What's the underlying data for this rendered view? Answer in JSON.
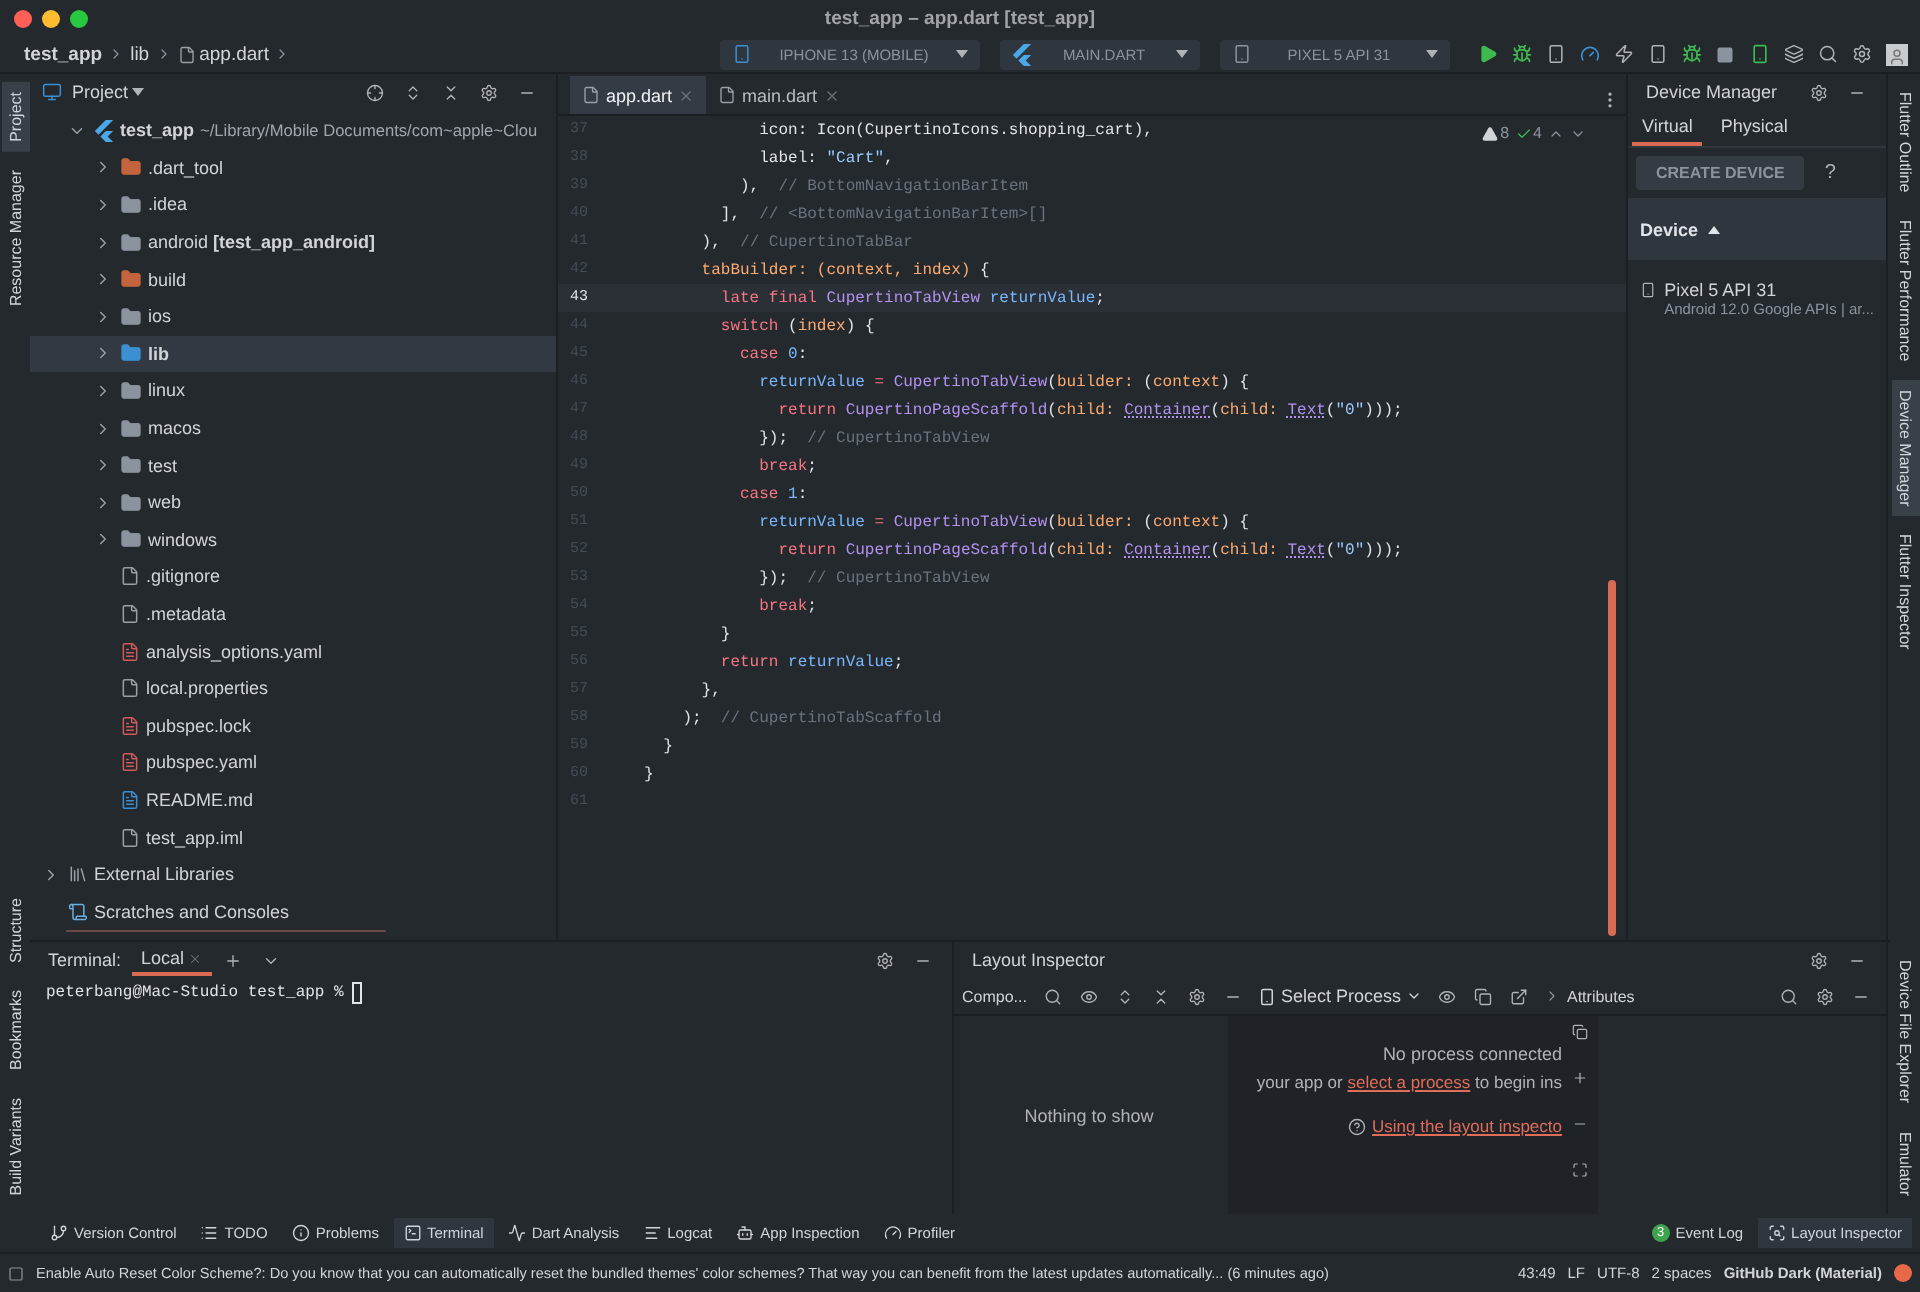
{
  "window": {
    "title": "test_app – app.dart [test_app]"
  },
  "breadcrumb": [
    "test_app",
    "lib",
    "app.dart"
  ],
  "run_toolbar": {
    "device": "IPHONE 13 (MOBILE)",
    "config": "MAIN.DART",
    "target": "PIXEL 5 API 31"
  },
  "left_tool_strip": {
    "top": [
      {
        "label": "Project",
        "selected": true
      },
      {
        "label": "Resource Manager",
        "selected": false
      }
    ],
    "bottom": [
      {
        "label": "Structure",
        "selected": false
      },
      {
        "label": "Bookmarks",
        "selected": false
      },
      {
        "label": "Build Variants",
        "selected": false
      }
    ]
  },
  "project_panel": {
    "title": "Project",
    "tree": [
      {
        "name": "test_app",
        "path": "~/Library/Mobile Documents/com~apple~Clou",
        "kind": "project",
        "expanded": true,
        "selected": false,
        "children": [
          {
            "name": ".dart_tool",
            "kind": "folder",
            "color": "#c4643c",
            "expanded": false,
            "selected": false
          },
          {
            "name": ".idea",
            "kind": "folder",
            "color": "#8b949e",
            "expanded": false,
            "selected": false
          },
          {
            "name": "android **[test_app_android]**",
            "kind": "folder",
            "color": "#8b949e",
            "expanded": false,
            "selected": false
          },
          {
            "name": "build",
            "kind": "folder",
            "color": "#c4643c",
            "expanded": false,
            "selected": false
          },
          {
            "name": "ios",
            "kind": "folder",
            "color": "#8b949e",
            "expanded": false,
            "selected": false
          },
          {
            "name": "lib",
            "kind": "folder",
            "color": "#3c8fd0",
            "expanded": false,
            "selected": true
          },
          {
            "name": "linux",
            "kind": "folder",
            "color": "#8b949e",
            "expanded": false,
            "selected": false
          },
          {
            "name": "macos",
            "kind": "folder",
            "color": "#8b949e",
            "expanded": false,
            "selected": false
          },
          {
            "name": "test",
            "kind": "folder",
            "color": "#8b949e",
            "expanded": false,
            "selected": false
          },
          {
            "name": "web",
            "kind": "folder",
            "color": "#8b949e",
            "expanded": false,
            "selected": false
          },
          {
            "name": "windows",
            "kind": "folder",
            "color": "#8b949e",
            "expanded": false,
            "selected": false
          },
          {
            "name": ".gitignore",
            "kind": "file",
            "selected": false
          },
          {
            "name": ".metadata",
            "kind": "file",
            "selected": false
          },
          {
            "name": "analysis_options.yaml",
            "kind": "yaml",
            "selected": false
          },
          {
            "name": "local.properties",
            "kind": "file",
            "selected": false
          },
          {
            "name": "pubspec.lock",
            "kind": "yaml",
            "selected": false
          },
          {
            "name": "pubspec.yaml",
            "kind": "yaml",
            "selected": false
          },
          {
            "name": "README.md",
            "kind": "markdown",
            "selected": false
          },
          {
            "name": "test_app.iml",
            "kind": "file",
            "selected": false
          }
        ]
      },
      {
        "name": "External Libraries",
        "kind": "library",
        "expanded": false,
        "selected": false
      },
      {
        "name": "Scratches and Consoles",
        "kind": "scratch",
        "selected": false
      }
    ]
  },
  "editor": {
    "tabs": [
      {
        "label": "app.dart",
        "selected": true
      },
      {
        "label": "main.dart",
        "selected": false
      }
    ],
    "inspections": {
      "warnings": "8",
      "passed": "4"
    },
    "lines": [
      {
        "number": "37",
        "current": false,
        "segments": [
          {
            "kind": "plain",
            "text": "            icon: Icon(CupertinoIcons.shopping_cart),"
          }
        ]
      },
      {
        "number": "38",
        "current": false,
        "segments": [
          {
            "kind": "plain",
            "text": "            label: "
          },
          {
            "kind": "string",
            "text": "\"Cart\""
          },
          {
            "kind": "plain",
            "text": ","
          }
        ]
      },
      {
        "number": "39",
        "current": false,
        "segments": [
          {
            "kind": "plain",
            "text": "          ),  "
          },
          {
            "kind": "comment",
            "text": "// BottomNavigationBarItem"
          }
        ]
      },
      {
        "number": "40",
        "current": false,
        "segments": [
          {
            "kind": "plain",
            "text": "        ],  "
          },
          {
            "kind": "comment",
            "text": "// <BottomNavigationBarItem>[]"
          }
        ]
      },
      {
        "number": "41",
        "current": false,
        "segments": [
          {
            "kind": "plain",
            "text": "      ),  "
          },
          {
            "kind": "comment",
            "text": "// CupertinoTabBar"
          }
        ]
      },
      {
        "number": "42",
        "current": false,
        "segments": [
          {
            "kind": "param",
            "text": "      tabBuilder: (context, index) "
          },
          {
            "kind": "plain",
            "text": "{"
          }
        ]
      },
      {
        "number": "43",
        "current": true,
        "segments": [
          {
            "kind": "keyword",
            "text": "        late final "
          },
          {
            "kind": "type",
            "text": "CupertinoTabView "
          },
          {
            "kind": "variable",
            "text": "returnValue"
          },
          {
            "kind": "plain",
            "text": ";"
          }
        ]
      },
      {
        "number": "44",
        "current": false,
        "segments": [
          {
            "kind": "keyword",
            "text": "        switch "
          },
          {
            "kind": "plain",
            "text": "("
          },
          {
            "kind": "param",
            "text": "index"
          },
          {
            "kind": "plain",
            "text": ") {"
          }
        ]
      },
      {
        "number": "45",
        "current": false,
        "segments": [
          {
            "kind": "keyword",
            "text": "          case "
          },
          {
            "kind": "variable",
            "text": "0"
          },
          {
            "kind": "plain",
            "text": ":"
          }
        ]
      },
      {
        "number": "46",
        "current": false,
        "segments": [
          {
            "kind": "variable",
            "text": "            returnValue "
          },
          {
            "kind": "keyword",
            "text": "= "
          },
          {
            "kind": "type",
            "text": "CupertinoTabView"
          },
          {
            "kind": "plain",
            "text": "("
          },
          {
            "kind": "param",
            "text": "builder: "
          },
          {
            "kind": "plain",
            "text": "("
          },
          {
            "kind": "param",
            "text": "context"
          },
          {
            "kind": "plain",
            "text": ") {"
          }
        ]
      },
      {
        "number": "47",
        "current": false,
        "segments": [
          {
            "kind": "keyword",
            "text": "              return "
          },
          {
            "kind": "type",
            "text": "CupertinoPageScaffold"
          },
          {
            "kind": "plain",
            "text": "("
          },
          {
            "kind": "param",
            "text": "child: "
          },
          {
            "kind": "link",
            "text": "Container"
          },
          {
            "kind": "plain",
            "text": "("
          },
          {
            "kind": "param",
            "text": "child: "
          },
          {
            "kind": "link",
            "text": "Text"
          },
          {
            "kind": "plain",
            "text": "("
          },
          {
            "kind": "string",
            "text": "\"0\""
          },
          {
            "kind": "plain",
            "text": ")));"
          }
        ]
      },
      {
        "number": "48",
        "current": false,
        "segments": [
          {
            "kind": "plain",
            "text": "            });  "
          },
          {
            "kind": "comment",
            "text": "// CupertinoTabView"
          }
        ]
      },
      {
        "number": "49",
        "current": false,
        "segments": [
          {
            "kind": "keyword",
            "text": "            break"
          },
          {
            "kind": "plain",
            "text": ";"
          }
        ]
      },
      {
        "number": "50",
        "current": false,
        "segments": [
          {
            "kind": "keyword",
            "text": "          case "
          },
          {
            "kind": "variable",
            "text": "1"
          },
          {
            "kind": "plain",
            "text": ":"
          }
        ]
      },
      {
        "number": "51",
        "current": false,
        "segments": [
          {
            "kind": "variable",
            "text": "            returnValue "
          },
          {
            "kind": "keyword",
            "text": "= "
          },
          {
            "kind": "type",
            "text": "CupertinoTabView"
          },
          {
            "kind": "plain",
            "text": "("
          },
          {
            "kind": "param",
            "text": "builder: "
          },
          {
            "kind": "plain",
            "text": "("
          },
          {
            "kind": "param",
            "text": "context"
          },
          {
            "kind": "plain",
            "text": ") {"
          }
        ]
      },
      {
        "number": "52",
        "current": false,
        "segments": [
          {
            "kind": "keyword",
            "text": "              return "
          },
          {
            "kind": "type",
            "text": "CupertinoPageScaffold"
          },
          {
            "kind": "plain",
            "text": "("
          },
          {
            "kind": "param",
            "text": "child: "
          },
          {
            "kind": "link",
            "text": "Container"
          },
          {
            "kind": "plain",
            "text": "("
          },
          {
            "kind": "param",
            "text": "child: "
          },
          {
            "kind": "link",
            "text": "Text"
          },
          {
            "kind": "plain",
            "text": "("
          },
          {
            "kind": "string",
            "text": "\"0\""
          },
          {
            "kind": "plain",
            "text": ")));"
          }
        ]
      },
      {
        "number": "53",
        "current": false,
        "segments": [
          {
            "kind": "plain",
            "text": "            });  "
          },
          {
            "kind": "comment",
            "text": "// CupertinoTabView"
          }
        ]
      },
      {
        "number": "54",
        "current": false,
        "segments": [
          {
            "kind": "keyword",
            "text": "            break"
          },
          {
            "kind": "plain",
            "text": ";"
          }
        ]
      },
      {
        "number": "55",
        "current": false,
        "segments": [
          {
            "kind": "plain",
            "text": "        }"
          }
        ]
      },
      {
        "number": "56",
        "current": false,
        "segments": [
          {
            "kind": "keyword",
            "text": "        return "
          },
          {
            "kind": "variable",
            "text": "returnValue"
          },
          {
            "kind": "plain",
            "text": ";"
          }
        ]
      },
      {
        "number": "57",
        "current": false,
        "segments": [
          {
            "kind": "plain",
            "text": "      },"
          }
        ]
      },
      {
        "number": "58",
        "current": false,
        "segments": [
          {
            "kind": "plain",
            "text": "    );  "
          },
          {
            "kind": "comment",
            "text": "// CupertinoTabScaffold"
          }
        ]
      },
      {
        "number": "59",
        "current": false,
        "segments": [
          {
            "kind": "plain",
            "text": "  }"
          }
        ]
      },
      {
        "number": "60",
        "current": false,
        "segments": [
          {
            "kind": "plain",
            "text": "}"
          }
        ]
      },
      {
        "number": "61",
        "current": false
      }
    ]
  },
  "device_manager": {
    "title": "Device Manager",
    "tabs": [
      {
        "label": "Virtual",
        "selected": true
      },
      {
        "label": "Physical",
        "selected": false
      }
    ],
    "create_button": "CREATE DEVICE",
    "help": "?",
    "column_header": "Device",
    "devices": [
      {
        "name": "Pixel 5 API 31",
        "detail": "Android 12.0 Google APIs | ar..."
      }
    ]
  },
  "right_tool_strip": {
    "top": [
      {
        "label": "Flutter Outline",
        "selected": false
      },
      {
        "label": "Flutter Performance",
        "selected": false
      },
      {
        "label": "Device Manager",
        "selected": true
      },
      {
        "label": "Flutter Inspector",
        "selected": false
      }
    ],
    "bottom": [
      {
        "label": "Device File Explorer",
        "selected": false
      },
      {
        "label": "Emulator",
        "selected": false
      }
    ]
  },
  "terminal": {
    "title": "Terminal:",
    "tabs": [
      {
        "label": "Local",
        "selected": true
      }
    ],
    "prompt": "peterbang@Mac-Studio test_app %"
  },
  "layout_inspector": {
    "title": "Layout Inspector",
    "component_tree": "Compo...",
    "process_selector": "Select Process",
    "attributes": "Attributes",
    "empty_tree": "Nothing to show",
    "status": "No process connected",
    "hint": {
      "before": "your app or ",
      "link": "select a process",
      "after": " to begin ins"
    },
    "help_link": "Using the layout inspecto"
  },
  "tool_window_bar": {
    "left": [
      {
        "label": "Version Control",
        "kind": "vcs",
        "selected": false
      },
      {
        "label": "TODO",
        "kind": "todo",
        "selected": false
      },
      {
        "label": "Problems",
        "kind": "problems",
        "selected": false
      },
      {
        "label": "Terminal",
        "kind": "terminal",
        "selected": true
      },
      {
        "label": "Dart Analysis",
        "kind": "dart",
        "selected": false
      },
      {
        "label": "Logcat",
        "kind": "logcat",
        "selected": false
      },
      {
        "label": "App Inspection",
        "kind": "inspection",
        "selected": false
      },
      {
        "label": "Profiler",
        "kind": "profiler",
        "selected": false
      }
    ],
    "right": [
      {
        "label": "Event Log",
        "kind": "event_log",
        "badge": "3",
        "selected": false
      },
      {
        "label": "Layout Inspector",
        "kind": "layout_inspector",
        "selected": true
      }
    ]
  },
  "status_bar": {
    "message": "Enable Auto Reset Color Scheme?: Do you know that you can automatically reset the bundled themes' color schemes? That way you can benefit from the latest updates automatically... (6 minutes ago)",
    "position": "43:49",
    "line_separator": "LF",
    "encoding": "UTF-8",
    "indent": "2 spaces",
    "theme": "GitHub Dark (Material)"
  }
}
